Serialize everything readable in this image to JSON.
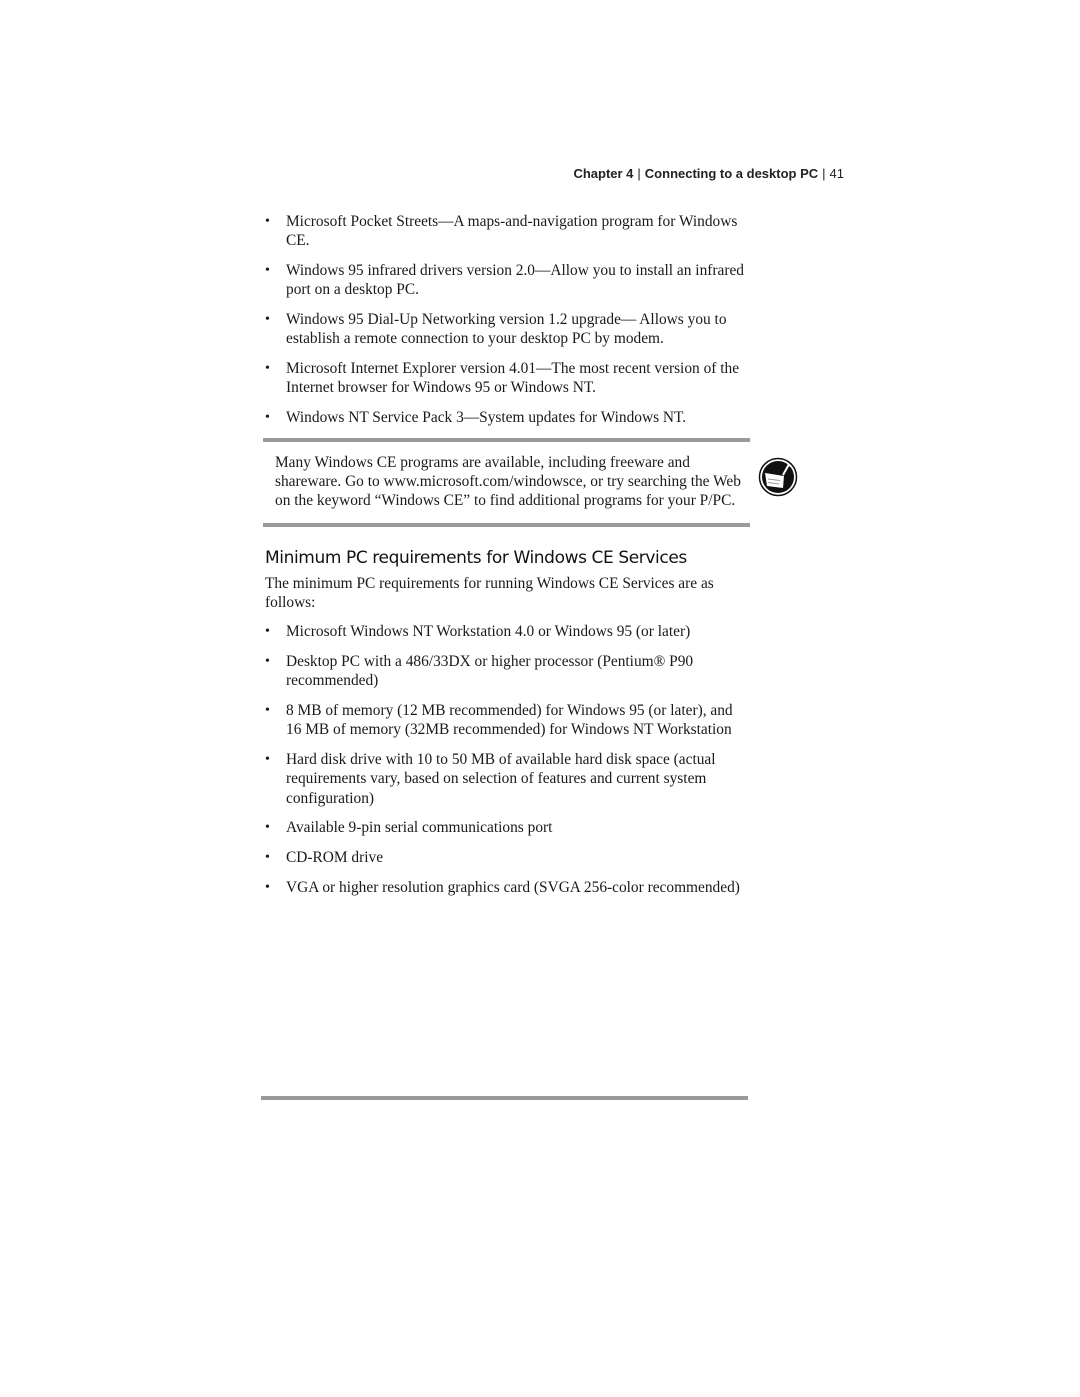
{
  "header": {
    "chapter": "Chapter 4",
    "chapter_title": "Connecting to a desktop PC",
    "page_number": "41",
    "separator": "|"
  },
  "top_list": [
    "Microsoft Pocket Streets—A maps-and-navigation program for Windows CE.",
    "Windows 95 infrared drivers version 2.0—Allow you to install an infrared port on a desktop PC.",
    "Windows 95 Dial-Up Networking version 1.2 upgrade— Allows you to establish a remote connection to your desktop PC by modem.",
    "Microsoft Internet Explorer version 4.01—The most recent version of the Internet browser for Windows 95 or Windows NT.",
    "Windows NT Service Pack 3—System updates for Windows NT."
  ],
  "note": {
    "text": "Many Windows CE programs are available, including freeware and shareware. Go to www.microsoft.com/windowsce, or try searching the Web on the keyword “Windows CE” to find additional programs for your P/PC.",
    "icon": "note-pen-icon"
  },
  "section": {
    "heading": "Minimum PC requirements for Windows CE Services",
    "intro": "The minimum PC requirements for running Windows CE Services are as follows:",
    "items": [
      "Microsoft Windows NT Workstation 4.0 or Windows 95 (or later)",
      "Desktop PC with a 486/33DX or higher processor (Pentium® P90 recommended)",
      "8 MB of memory (12 MB recommended) for Windows 95 (or later), and 16 MB of memory (32MB recommended) for Windows NT Workstation",
      "Hard disk drive with 10 to 50 MB of available hard disk space (actual requirements vary, based on selection of features and current system configuration)",
      "Available 9-pin serial communications port",
      "CD-ROM drive",
      "VGA or higher resolution graphics card (SVGA 256-color recommended)"
    ]
  },
  "bullet_glyph": "•",
  "colors": {
    "rule": "#9a9a9a",
    "text": "#1a1a1a"
  }
}
